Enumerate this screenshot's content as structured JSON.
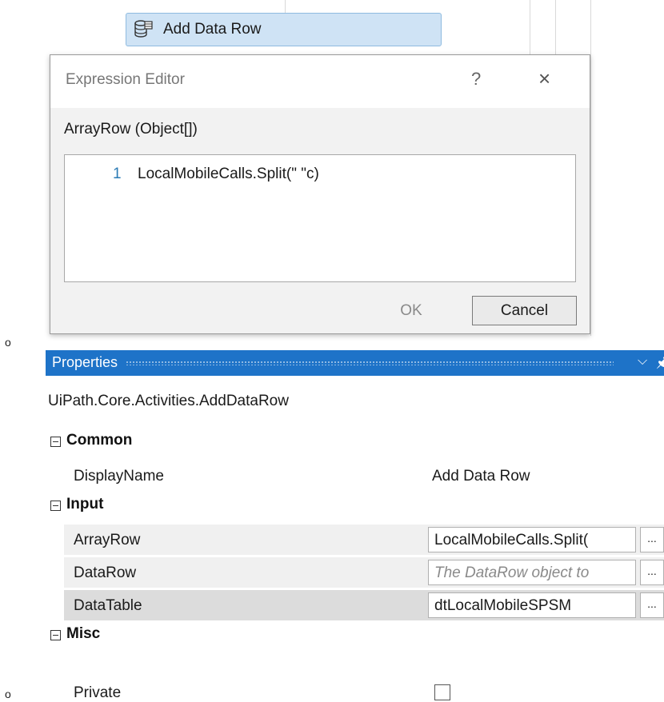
{
  "designer": {
    "activity_label": "Add Data Row",
    "activity_icon": "data-row-icon"
  },
  "expression_editor": {
    "title": "Expression Editor",
    "help_label": "?",
    "close_label": "×",
    "argument_label": "ArrayRow (Object[])",
    "line_number": "1",
    "code": "LocalMobileCalls.Split(\" \"c)",
    "ok_label": "OK",
    "cancel_label": "Cancel"
  },
  "properties": {
    "header": "Properties",
    "chevron_icon": "chevron-down-icon",
    "pin_icon": "pin-icon",
    "class_name": "UiPath.Core.Activities.AddDataRow",
    "categories": {
      "common": {
        "label": "Common",
        "display_name": {
          "name": "DisplayName",
          "value": "Add Data Row"
        }
      },
      "input": {
        "label": "Input",
        "array_row": {
          "name": "ArrayRow",
          "value": "LocalMobileCalls.Split("
        },
        "data_row": {
          "name": "DataRow",
          "placeholder": "The DataRow object to"
        },
        "data_table": {
          "name": "DataTable",
          "value": "dtLocalMobileSPSM"
        }
      },
      "misc": {
        "label": "Misc",
        "private": {
          "name": "Private",
          "checked": false
        }
      }
    },
    "ellipsis_label": "..."
  },
  "bullets": [
    "o",
    "o"
  ],
  "colors": {
    "header_blue": "#1e73c8",
    "activity_fill": "#cfe3f5",
    "line_number_blue": "#2b7bb5"
  }
}
